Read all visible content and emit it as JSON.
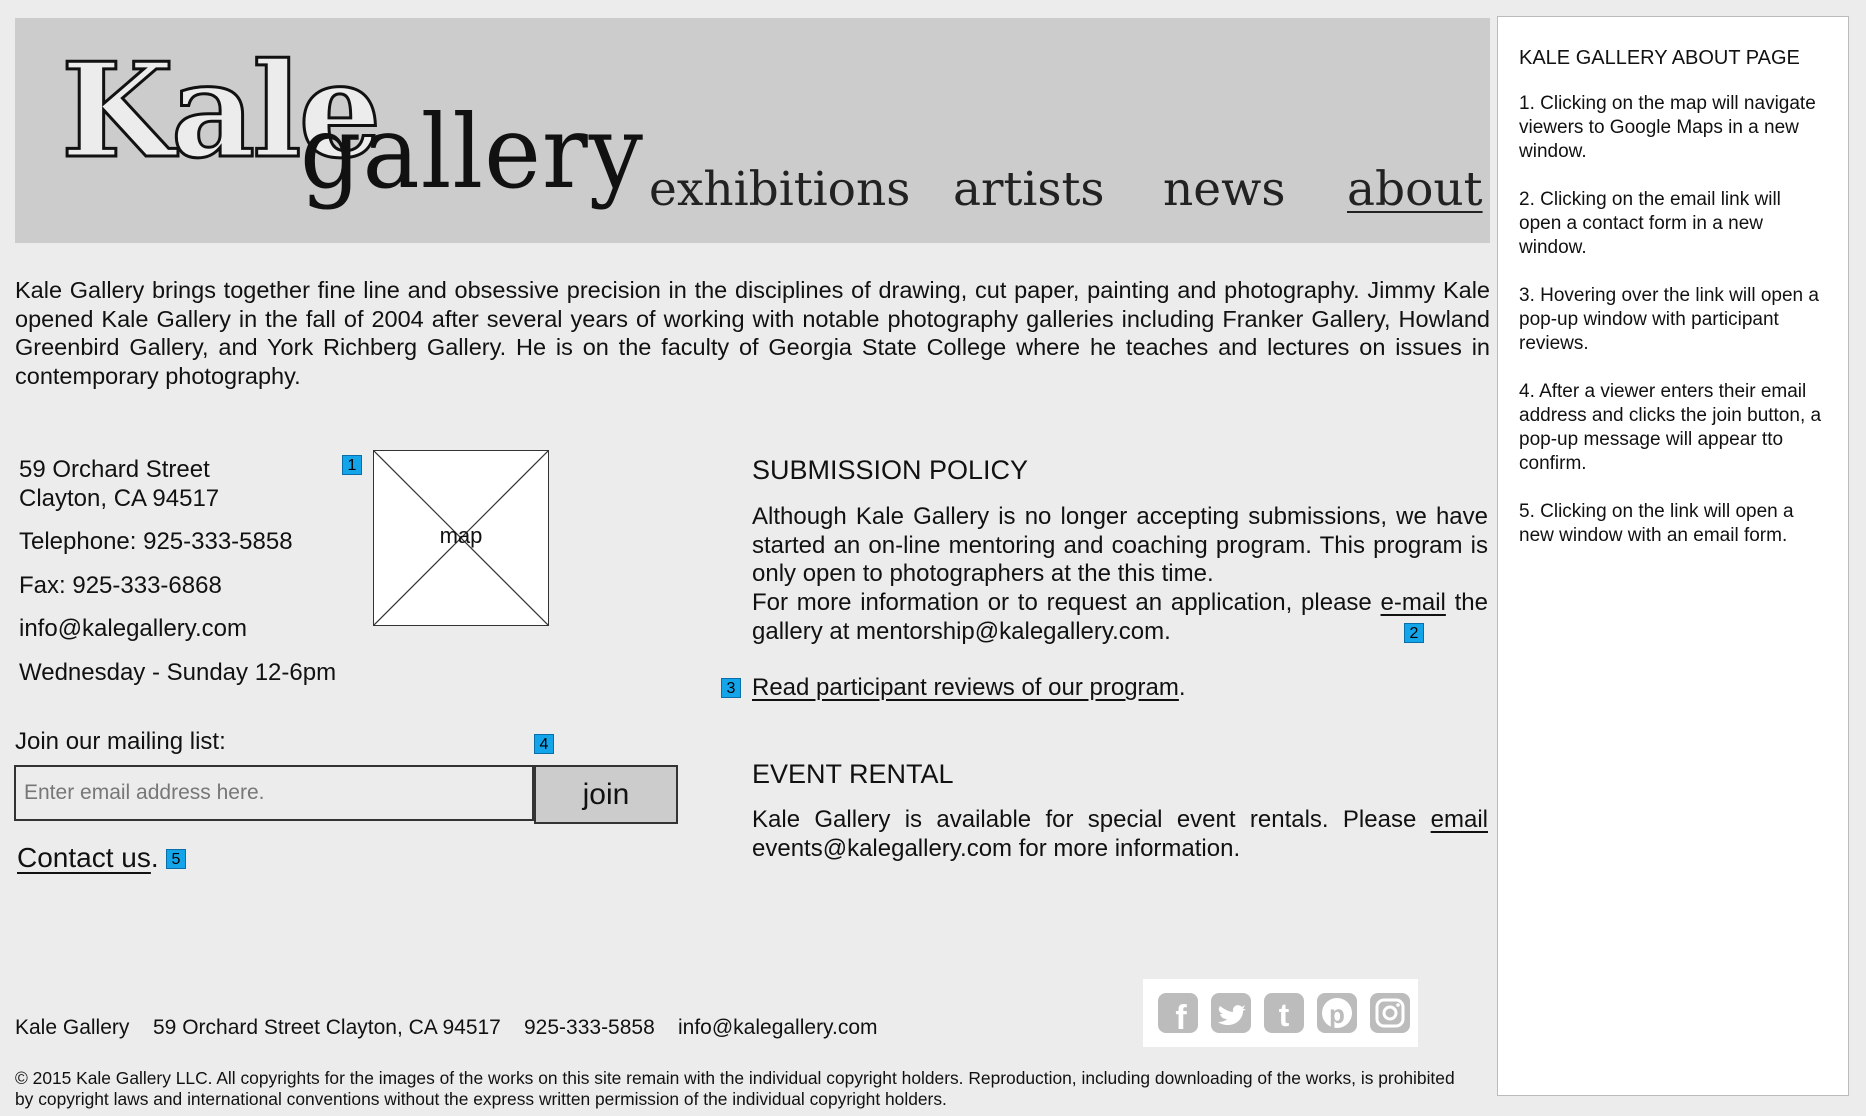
{
  "header": {
    "logo_main": "Kale",
    "logo_sub": "gallery",
    "nav": [
      "exhibitions",
      "artists",
      "news",
      "about"
    ]
  },
  "intro": "Kale Gallery brings together fine line and obsessive precision in the disciplines of drawing, cut paper, painting and photography. Jimmy Kale opened Kale Gallery in the fall of 2004 after several years of working with notable photography galleries including Franker Gallery, Howland Greenbird Gallery, and York Richberg Gallery. He is on the faculty of Georgia State College where he teaches and lectures on issues in contemporary photography.",
  "contact": {
    "address1": "59 Orchard Street",
    "address2": "Clayton, CA 94517",
    "telephone": "Telephone: 925-333-5858",
    "fax": "Fax: 925-333-6868",
    "email": "info@kalegallery.com",
    "hours": "Wednesday - Sunday 12-6pm",
    "map_label": "map"
  },
  "badges": {
    "b1": "1",
    "b2": "2",
    "b3": "3",
    "b4": "4",
    "b5": "5"
  },
  "mailing": {
    "label": "Join our mailing list:",
    "placeholder": "Enter email address here.",
    "button": "join"
  },
  "contact_link": {
    "text": "Contact us",
    "suffix": "."
  },
  "submission": {
    "title": "SUBMISSION POLICY",
    "para1": "Although Kale Gallery is no longer accepting submissions, we have started an on-line mentoring and coaching program. This program is only open to photographers at the this time.",
    "para2_before": "For more information or to request an application, please ",
    "para2_link": "e-mail",
    "para2_after": " the gallery at mentorship@kalegallery.com.",
    "reviews_link": "Read participant reviews of our program",
    "reviews_suffix": "."
  },
  "rental": {
    "title": "EVENT RENTAL",
    "before": "Kale Gallery is available for special event rentals. Please ",
    "link": "email",
    "after": " events@kalegallery.com for more information."
  },
  "footer": {
    "name": "Kale Gallery",
    "address": "59 Orchard Street Clayton, CA 94517",
    "phone": "925-333-5858",
    "email": "info@kalegallery.com",
    "social_icons": [
      "facebook-icon",
      "twitter-icon",
      "tumblr-icon",
      "pinterest-icon",
      "instagram-icon"
    ],
    "copyright": "© 2015 Kale Gallery LLC. All copyrights for the images of the works on this site remain with the individual copyright holders. Reproduction, including downloading of the works, is prohibited by copyright laws and international conventions without the express written permission of the individual copyright holders."
  },
  "notes": {
    "title": "KALE GALLERY ABOUT PAGE",
    "items": [
      "1. Clicking on the map will navigate viewers to Google Maps in a new window.",
      "2. Clicking on the email link will open a contact form in a new window.",
      "3. Hovering over the link will open a pop-up window with participant reviews.",
      "4. After a viewer enters their email address and clicks the join button, a pop-up message will appear tto confirm.",
      "5. Clicking on the link will open a new window with an email form."
    ]
  },
  "colors": {
    "page": "#ececec",
    "header": "#cccccc",
    "badge": "#14a4ea",
    "social": "#bcbcbc"
  }
}
